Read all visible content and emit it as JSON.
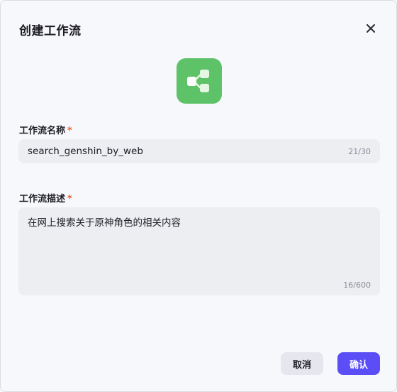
{
  "dialog": {
    "title": "创建工作流",
    "close_icon": "close-icon",
    "app_icon": "workflow-icon",
    "app_icon_color": "#5ec269"
  },
  "fields": {
    "name": {
      "label": "工作流名称",
      "required_mark": "*",
      "value": "search_genshin_by_web",
      "count": "21/30"
    },
    "description": {
      "label": "工作流描述",
      "required_mark": "*",
      "value": "在网上搜索关于原神角色的相关内容",
      "count": "16/600"
    }
  },
  "footer": {
    "cancel_label": "取消",
    "confirm_label": "确认",
    "confirm_color": "#5b4ef7",
    "required_color": "#f0632a"
  }
}
